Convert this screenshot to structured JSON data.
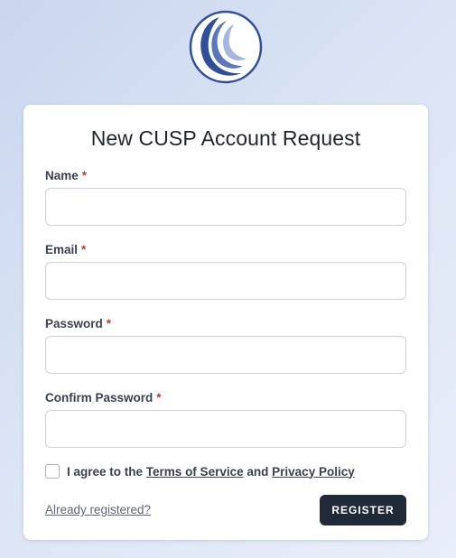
{
  "logo": {
    "icon": "cusp-swirl-logo-icon",
    "colors": [
      "#2f4f98",
      "#6d87c6",
      "#a5b6e0"
    ]
  },
  "form": {
    "title": "New CUSP Account Request",
    "required_marker": "*",
    "fields": [
      {
        "label": "Name",
        "value": "",
        "placeholder": ""
      },
      {
        "label": "Email",
        "value": "",
        "placeholder": ""
      },
      {
        "label": "Password",
        "value": "",
        "placeholder": ""
      },
      {
        "label": "Confirm Password",
        "value": "",
        "placeholder": ""
      }
    ],
    "agree": {
      "prefix": "I agree to the",
      "terms": "Terms of Service",
      "conj": "and",
      "privacy": "Privacy Policy",
      "checked": false
    },
    "already_registered": "Already registered?",
    "register_button": "REGISTER"
  },
  "colors": {
    "button": "#1f2937",
    "required": "#c0392b"
  }
}
